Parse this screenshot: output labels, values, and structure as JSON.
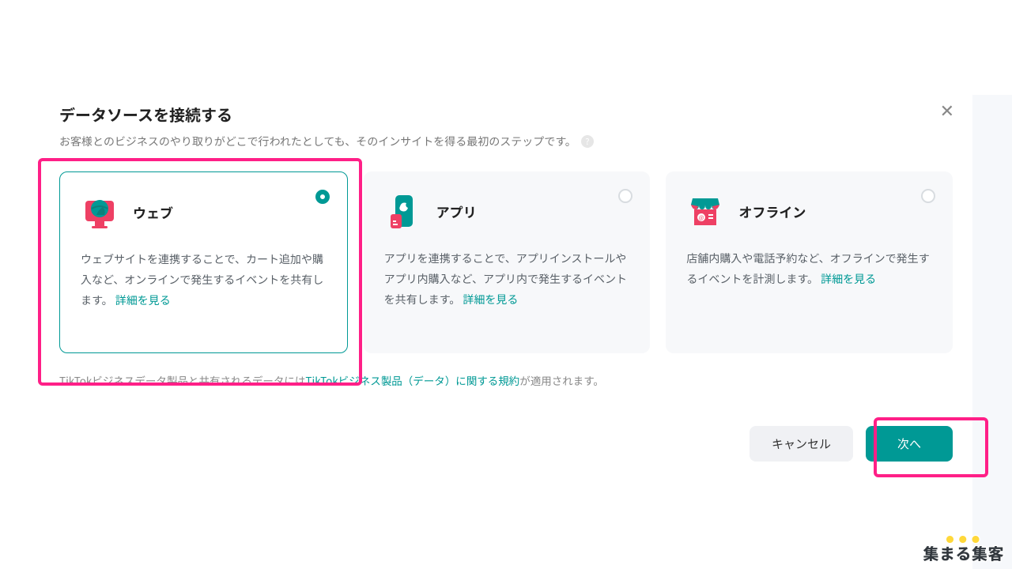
{
  "modal": {
    "title": "データソースを接続する",
    "subtitle": "お客様とのビジネスのやり取りがどこで行われたとしても、そのインサイトを得る最初のステップです。",
    "close_aria": "閉じる"
  },
  "cards": {
    "web": {
      "title": "ウェブ",
      "desc": "ウェブサイトを連携することで、カート追加や購入など、オンラインで発生するイベントを共有します。 ",
      "more": "詳細を見る"
    },
    "app": {
      "title": "アプリ",
      "desc": "アプリを連携することで、アプリインストールやアプリ内購入など、アプリ内で発生するイベントを共有します。 ",
      "more": "詳細を見る"
    },
    "offline": {
      "title": "オフライン",
      "desc": "店舗内購入や電話予約など、オフラインで発生するイベントを計測します。 ",
      "more": "詳細を見る"
    }
  },
  "disclosure": {
    "pre": "TikTokビジネスデータ製品と共有されるデータには",
    "link": "TikTokビジネス製品（データ）に関する規約",
    "post": "が適用されます。"
  },
  "footer": {
    "cancel": "キャンセル",
    "next": "次へ"
  },
  "brand": "集まる集客"
}
